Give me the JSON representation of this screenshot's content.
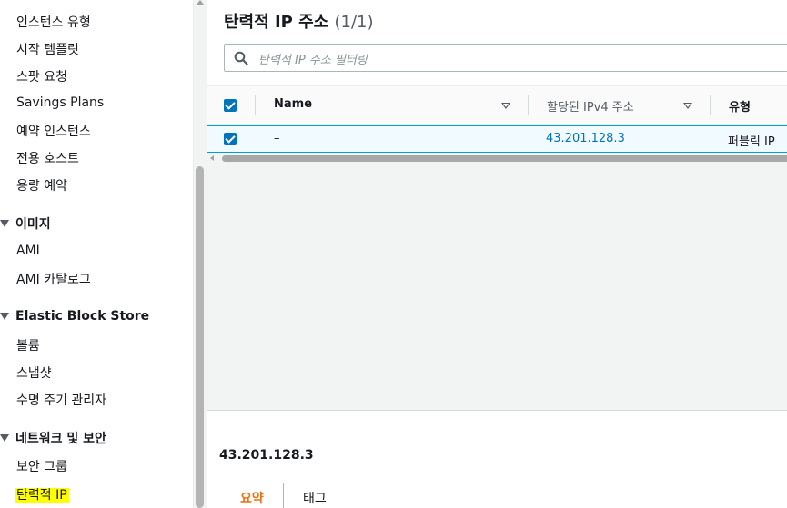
{
  "sidebar": {
    "items_top": [
      {
        "label": "인스턴스 유형"
      },
      {
        "label": "시작 템플릿"
      },
      {
        "label": "스팟 요청"
      },
      {
        "label": "Savings Plans"
      },
      {
        "label": "예약 인스턴스"
      },
      {
        "label": "전용 호스트"
      },
      {
        "label": "용량 예약"
      }
    ],
    "sections": [
      {
        "title": "이미지",
        "items": [
          {
            "label": "AMI"
          },
          {
            "label": "AMI 카탈로그"
          }
        ]
      },
      {
        "title": "Elastic Block Store",
        "items": [
          {
            "label": "볼륨"
          },
          {
            "label": "스냅샷"
          },
          {
            "label": "수명 주기 관리자"
          }
        ]
      },
      {
        "title": "네트워크 및 보안",
        "items": [
          {
            "label": "보안 그룹"
          },
          {
            "label": "탄력적 IP"
          }
        ]
      }
    ]
  },
  "main": {
    "title": "탄력적 IP 주소",
    "count": "(1/1)",
    "search": {
      "placeholder": "탄력적 IP 주소 필터링"
    },
    "table": {
      "columns": [
        {
          "label": "Name"
        },
        {
          "label": "할당된 IPv4 주소"
        },
        {
          "label": "유형"
        }
      ],
      "rows": [
        {
          "name": "–",
          "ipv4": "43.201.128.3",
          "type": "퍼블릭 IP",
          "selected": true
        }
      ]
    },
    "details": {
      "title": "43.201.128.3",
      "tabs": [
        {
          "label": "요약",
          "active": true
        },
        {
          "label": "태그",
          "active": false
        }
      ]
    }
  },
  "colors": {
    "accent": "#0073bb",
    "tab_active": "#ec7211",
    "highlight": "#ffff00"
  }
}
